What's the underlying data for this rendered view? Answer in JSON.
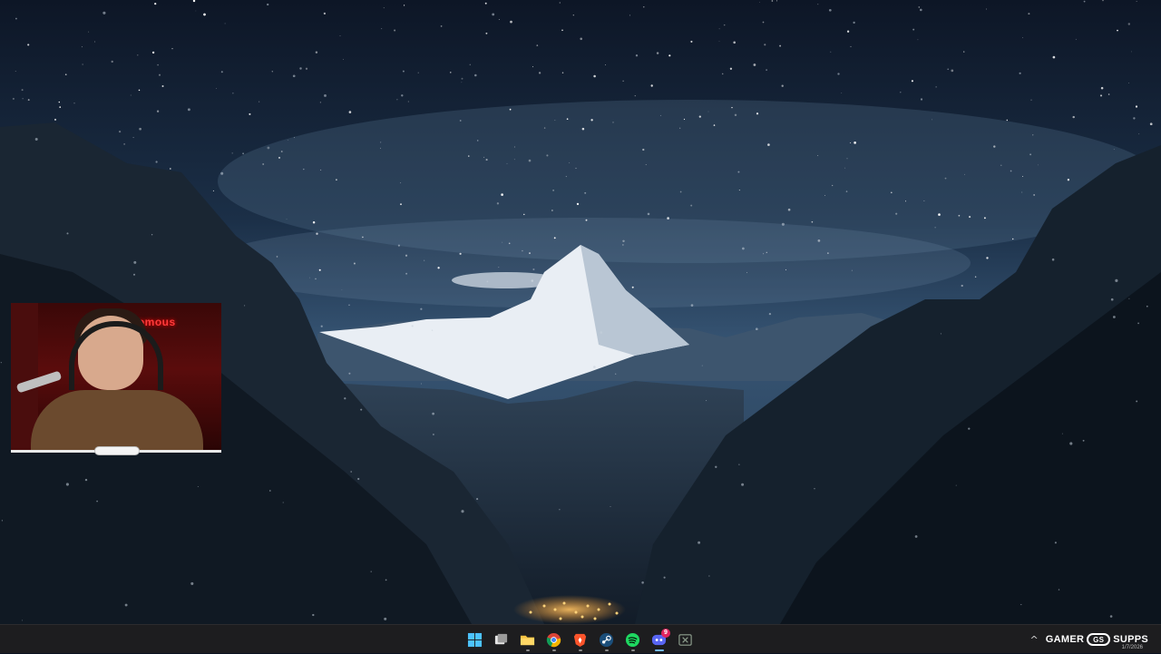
{
  "webcam": {
    "sign_text": "nomous"
  },
  "taskbar": {
    "apps": [
      {
        "name": "start",
        "label": "Start"
      },
      {
        "name": "task-view",
        "label": "Task View"
      },
      {
        "name": "file-explorer",
        "label": "File Explorer"
      },
      {
        "name": "chrome",
        "label": "Google Chrome"
      },
      {
        "name": "brave",
        "label": "Brave"
      },
      {
        "name": "steam",
        "label": "Steam"
      },
      {
        "name": "spotify",
        "label": "Spotify"
      },
      {
        "name": "discord",
        "label": "Discord",
        "badge": "9"
      },
      {
        "name": "excel",
        "label": "Excel"
      }
    ]
  },
  "tray": {
    "chevron": "^",
    "brand_left": "GAMER",
    "brand_logo": "GS",
    "brand_right": "SUPPS",
    "date": "1/7/2026"
  },
  "colors": {
    "sky_top": "#0e1a2e",
    "sky_mid": "#23405e",
    "taskbar": "#1d1d1f",
    "accent": "#74b9ff"
  }
}
